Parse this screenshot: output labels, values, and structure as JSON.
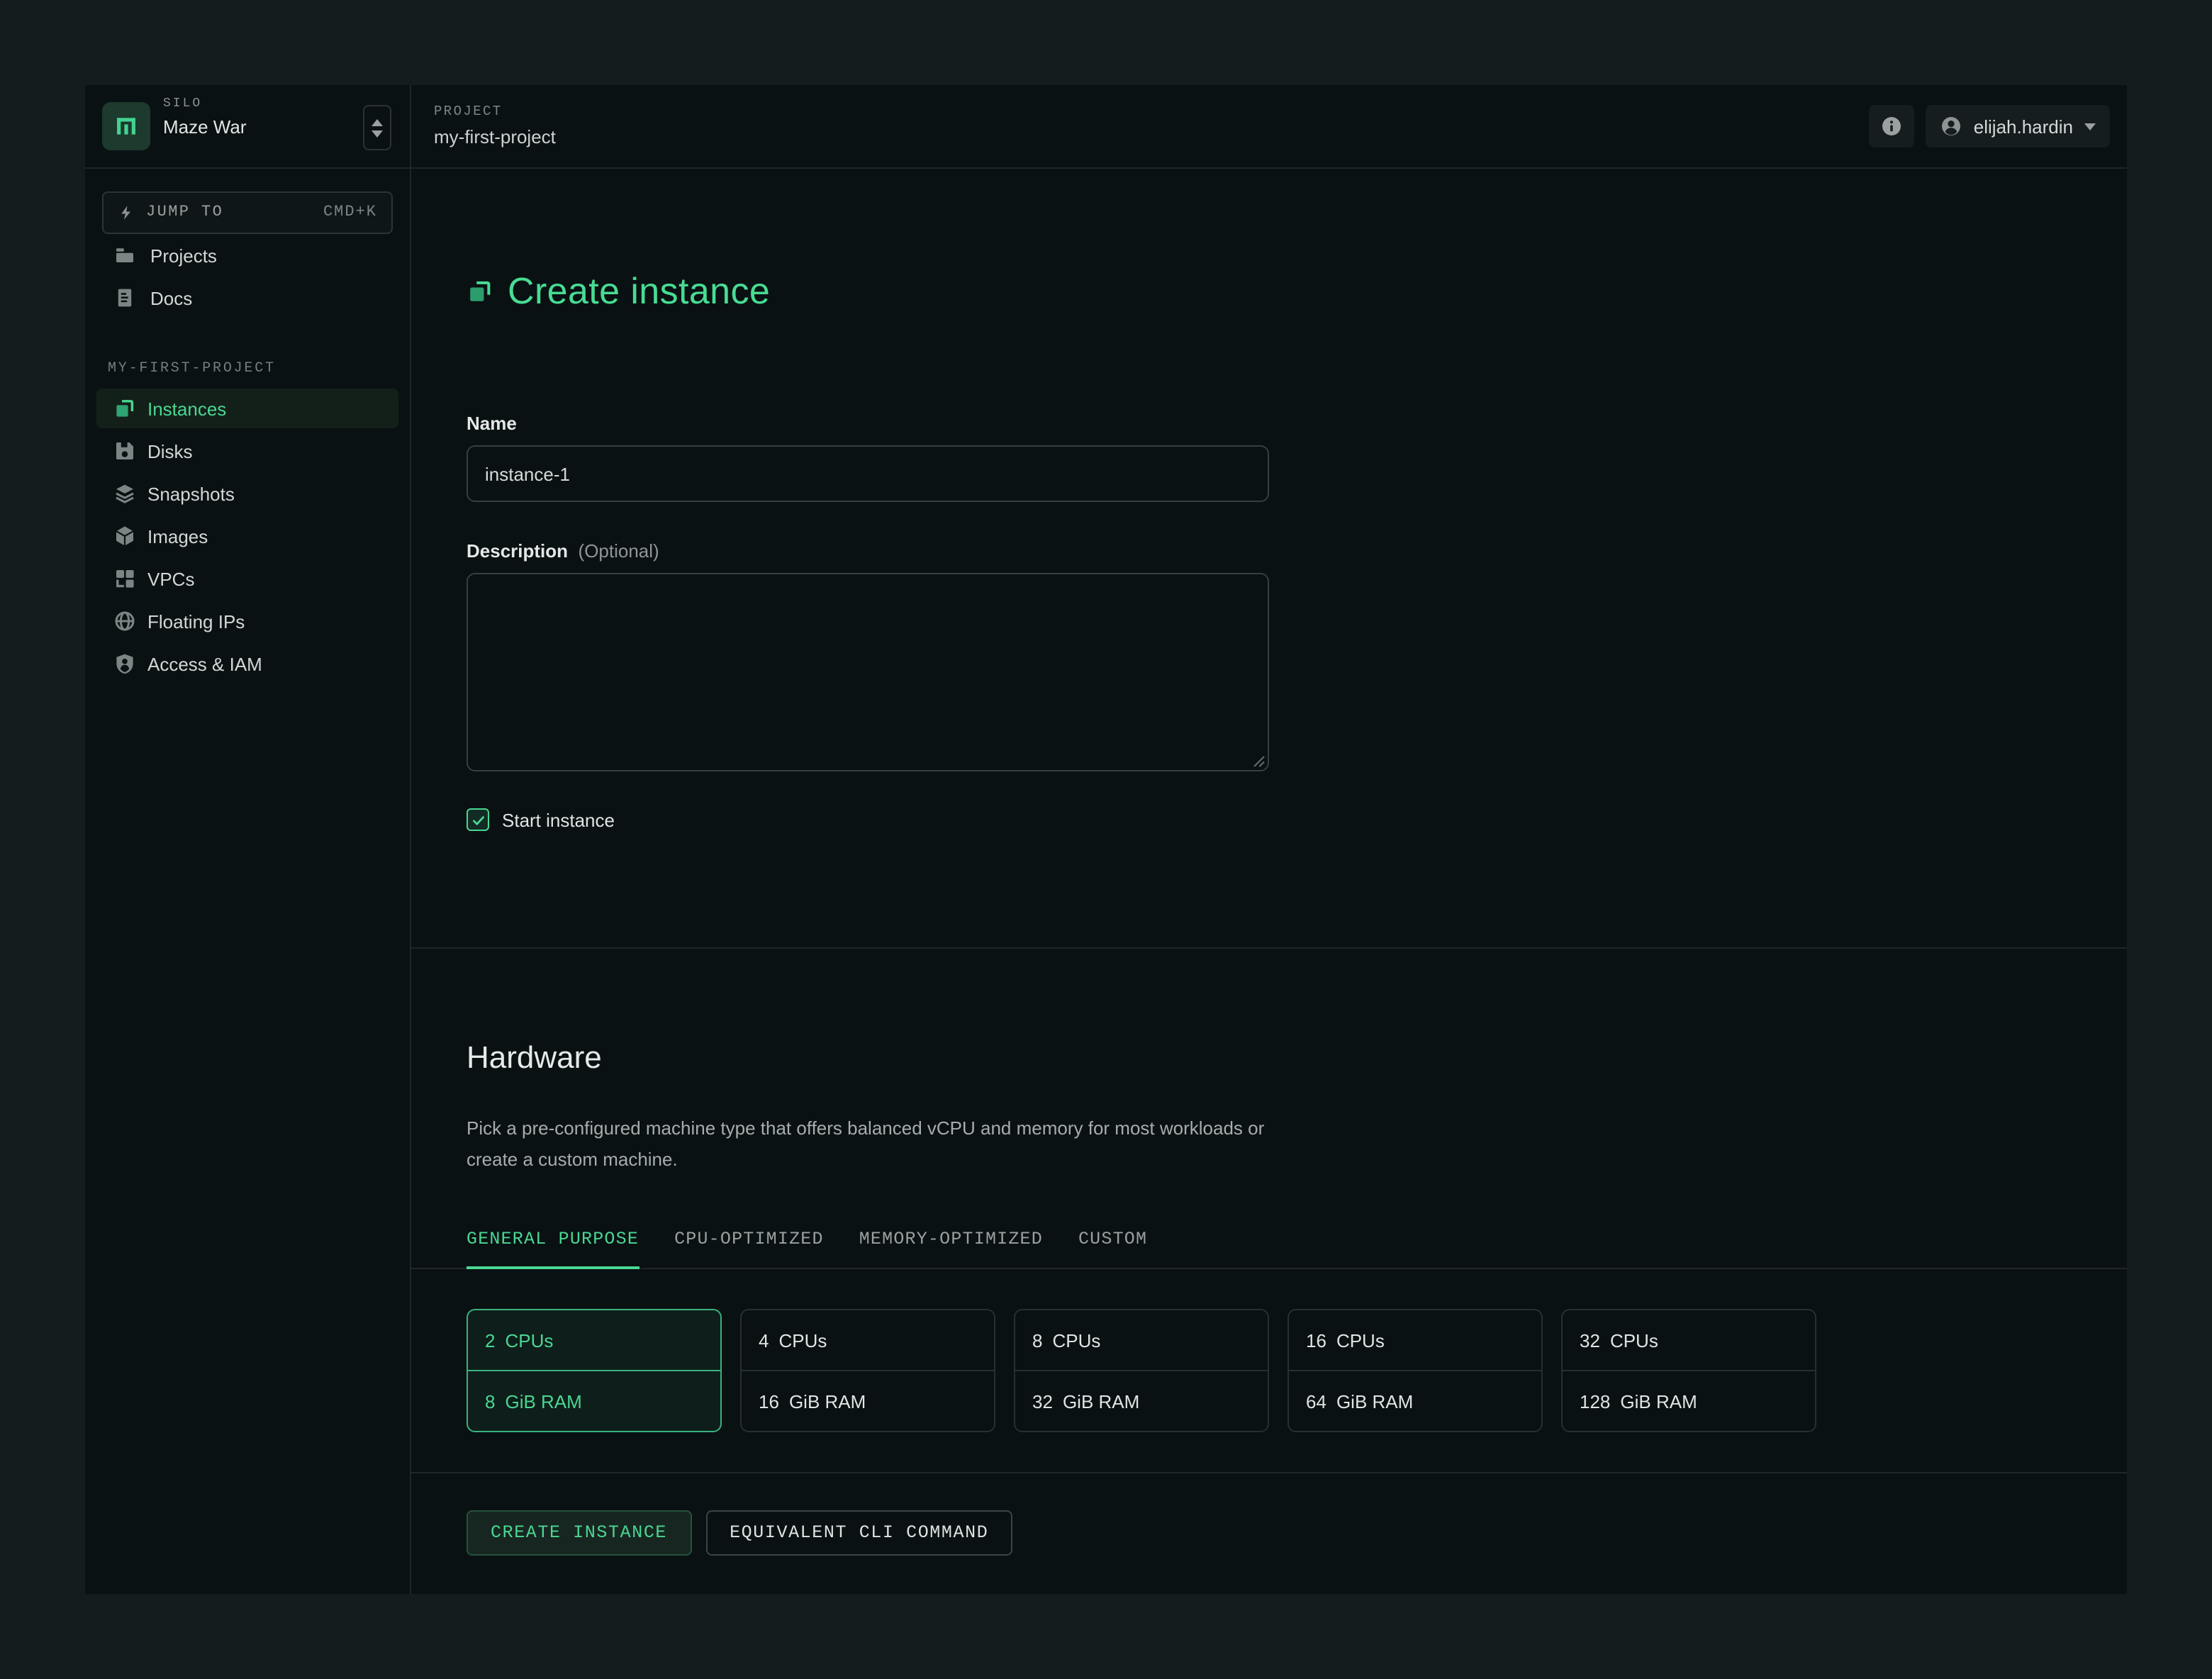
{
  "colors": {
    "accent": "#4ad792",
    "window_bg": "#0a1113",
    "outer_bg": "#151c1e",
    "divider": "#1e2628"
  },
  "topbar": {
    "silo_label": "SILO",
    "silo_name": "Maze War",
    "project_label": "PROJECT",
    "project_name": "my-first-project",
    "user_name": "elijah.hardin",
    "icons": [
      "info-icon",
      "user-avatar-icon",
      "caret-down-icon",
      "silo-picker-icon"
    ]
  },
  "sidebar": {
    "jump_to": {
      "label": "JUMP TO",
      "shortcut": "CMD+K",
      "icon": "bolt-icon"
    },
    "nav": [
      {
        "label": "Projects",
        "icon": "folder-icon"
      },
      {
        "label": "Docs",
        "icon": "document-icon"
      }
    ],
    "section_label": "MY-FIRST-PROJECT",
    "project_nav": [
      {
        "label": "Instances",
        "icon": "instances-icon",
        "selected": true
      },
      {
        "label": "Disks",
        "icon": "disk-icon",
        "selected": false
      },
      {
        "label": "Snapshots",
        "icon": "layers-icon",
        "selected": false
      },
      {
        "label": "Images",
        "icon": "cube-icon",
        "selected": false
      },
      {
        "label": "VPCs",
        "icon": "grid-icon",
        "selected": false
      },
      {
        "label": "Floating IPs",
        "icon": "globe-icon",
        "selected": false
      },
      {
        "label": "Access & IAM",
        "icon": "shield-person-icon",
        "selected": false
      }
    ]
  },
  "form": {
    "title": "Create instance",
    "title_icon": "instances-icon",
    "name_label": "Name",
    "name_value": "instance-1",
    "description_label": "Description",
    "description_optional": "(Optional)",
    "description_value": "",
    "start_instance_label": "Start instance",
    "start_instance_checked": true
  },
  "hardware": {
    "title": "Hardware",
    "description": "Pick a pre-configured machine type that offers balanced vCPU and memory for most workloads or create a custom machine.",
    "tabs": [
      {
        "label": "GENERAL PURPOSE",
        "active": true
      },
      {
        "label": "CPU-OPTIMIZED",
        "active": false
      },
      {
        "label": "MEMORY-OPTIMIZED",
        "active": false
      },
      {
        "label": "CUSTOM",
        "active": false
      }
    ],
    "options": [
      {
        "cpus": "2",
        "cpus_unit": "CPUs",
        "ram": "8",
        "ram_unit": "GiB RAM",
        "selected": true
      },
      {
        "cpus": "4",
        "cpus_unit": "CPUs",
        "ram": "16",
        "ram_unit": "GiB RAM",
        "selected": false
      },
      {
        "cpus": "8",
        "cpus_unit": "CPUs",
        "ram": "32",
        "ram_unit": "GiB RAM",
        "selected": false
      },
      {
        "cpus": "16",
        "cpus_unit": "CPUs",
        "ram": "64",
        "ram_unit": "GiB RAM",
        "selected": false
      },
      {
        "cpus": "32",
        "cpus_unit": "CPUs",
        "ram": "128",
        "ram_unit": "GiB RAM",
        "selected": false
      }
    ]
  },
  "actions": {
    "create_label": "CREATE INSTANCE",
    "cli_label": "EQUIVALENT CLI COMMAND"
  }
}
